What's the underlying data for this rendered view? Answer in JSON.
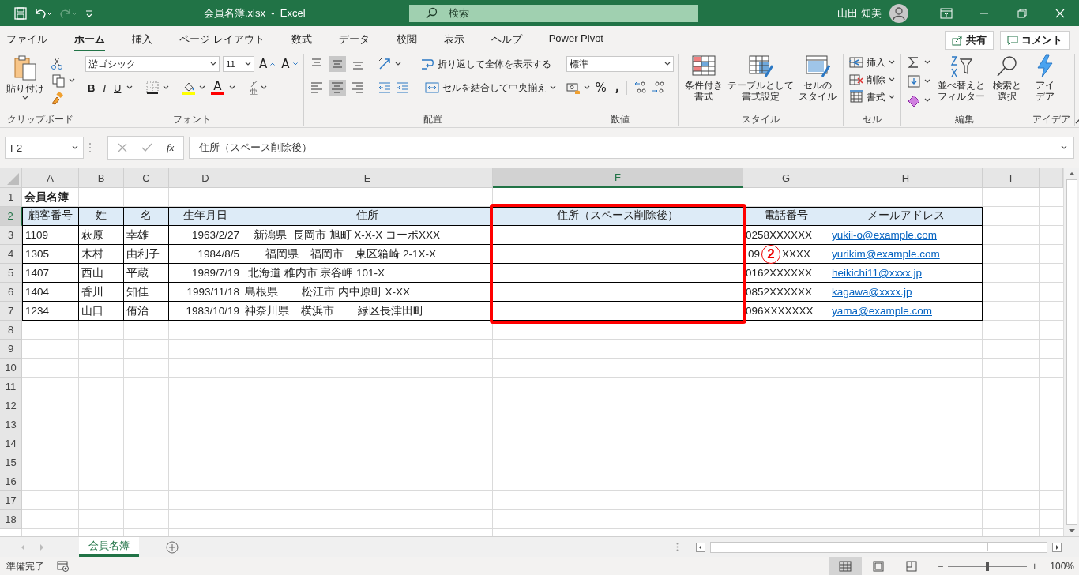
{
  "title_bar": {
    "file_title": "会員名簿.xlsx  -  Excel",
    "search_placeholder": "検索",
    "user": "山田 知美"
  },
  "ribbon_tabs": [
    {
      "label": "ファイル",
      "selected": false
    },
    {
      "label": "ホーム",
      "selected": true
    },
    {
      "label": "挿入",
      "selected": false
    },
    {
      "label": "ページ レイアウト",
      "selected": false
    },
    {
      "label": "数式",
      "selected": false
    },
    {
      "label": "データ",
      "selected": false
    },
    {
      "label": "校閲",
      "selected": false
    },
    {
      "label": "表示",
      "selected": false
    },
    {
      "label": "ヘルプ",
      "selected": false
    },
    {
      "label": "Power Pivot",
      "selected": false
    }
  ],
  "share_button": "共有",
  "comment_button": "コメント",
  "ribbon": {
    "clipboard": {
      "label": "クリップボード",
      "paste": "貼り付け"
    },
    "font": {
      "label": "フォント",
      "font_name": "游ゴシック",
      "font_size": "11",
      "grow": "A",
      "shrink": "A",
      "bold": "B",
      "italic": "I",
      "underline": "U",
      "font_color": "A",
      "phonetic": [
        "ア",
        "亜"
      ]
    },
    "alignment": {
      "label": "配置",
      "wrap_text": "折り返して全体を表示する",
      "merge": "セルを結合して中央揃え",
      "vertical": [
        {
          "kind": "top",
          "selected": false
        },
        {
          "kind": "middle",
          "selected": true
        },
        {
          "kind": "bottom",
          "selected": false
        }
      ],
      "horizontal": [
        {
          "kind": "left",
          "selected": false
        },
        {
          "kind": "center",
          "selected": true
        },
        {
          "kind": "right",
          "selected": false
        }
      ]
    },
    "number": {
      "label": "数値",
      "format": "標準",
      "percent": "%",
      "comma": ","
    },
    "styles": {
      "label": "スタイル",
      "buttons": [
        {
          "kind": "conditional",
          "lines": [
            "条件付き",
            "書式"
          ]
        },
        {
          "kind": "table",
          "lines": [
            "テーブルとして",
            "書式設定"
          ]
        },
        {
          "kind": "cell",
          "lines": [
            "セルの",
            "スタイル"
          ]
        }
      ]
    },
    "cells": {
      "label": "セル",
      "buttons": [
        {
          "kind": "insert",
          "label": "挿入"
        },
        {
          "kind": "delete",
          "label": "削除"
        },
        {
          "kind": "format",
          "label": "書式"
        }
      ]
    },
    "editing": {
      "label": "編集",
      "sort": [
        "並べ替えと",
        "フィルター"
      ],
      "find": [
        "検索と",
        "選択"
      ]
    },
    "ideas": {
      "label": "アイデア",
      "button": [
        "アイ",
        "デア"
      ]
    }
  },
  "formula_bar": {
    "name_box": "F2",
    "fx": "fx",
    "formula": "住所（スペース削除後）"
  },
  "columns": [
    {
      "label": "A",
      "selected": false,
      "highlighted": false
    },
    {
      "label": "B",
      "selected": false,
      "highlighted": false
    },
    {
      "label": "C",
      "selected": false,
      "highlighted": false
    },
    {
      "label": "D",
      "selected": false,
      "highlighted": false
    },
    {
      "label": "E",
      "selected": false,
      "highlighted": false
    },
    {
      "label": "F",
      "selected": true,
      "highlighted": true
    },
    {
      "label": "G",
      "selected": false,
      "highlighted": false
    },
    {
      "label": "H",
      "selected": false,
      "highlighted": false
    },
    {
      "label": "I",
      "selected": false,
      "highlighted": false
    }
  ],
  "rows": [
    {
      "number": "1",
      "selected": false,
      "kind": "title",
      "cells": [
        "会員名簿"
      ]
    },
    {
      "number": "2",
      "selected": true,
      "kind": "header",
      "cells": [
        "顧客番号",
        "姓",
        "名",
        "生年月日",
        "住所",
        "住所（スペース削除後）",
        "電話番号",
        "メールアドレス"
      ]
    },
    {
      "number": "3",
      "selected": false,
      "kind": "data",
      "cells": [
        "1109",
        "萩原",
        "幸雄",
        "1963/2/27",
        "   新潟県  長岡市 旭町 X-X-X コーポXXX",
        "",
        "0258XXXXXX",
        {
          "kind": "link",
          "text": "yukii-o@example.com"
        }
      ]
    },
    {
      "number": "4",
      "selected": false,
      "kind": "data",
      "cells": [
        "1305",
        "木村",
        "由利子",
        "1984/8/5",
        "       福岡県    福岡市    東区箱崎 2-1X-X",
        "",
        {
          "kind": "marked",
          "before": "09",
          "mark": "2",
          "after": "XXXX"
        },
        {
          "kind": "link",
          "text": "yurikim@example.com"
        }
      ]
    },
    {
      "number": "5",
      "selected": false,
      "kind": "data",
      "cells": [
        "1407",
        "西山",
        "平蔵",
        "1989/7/19",
        " 北海道 稚内市 宗谷岬 101-X",
        "",
        "0162XXXXXX",
        {
          "kind": "link",
          "text": "heikichi11@xxxx.jp"
        }
      ]
    },
    {
      "number": "6",
      "selected": false,
      "kind": "data",
      "cells": [
        "1404",
        "香川",
        "知佳",
        "1993/11/18",
        "島根県        松江市 内中原町 X-XX",
        "",
        "0852XXXXXX",
        {
          "kind": "link",
          "text": "kagawa@xxxx.jp"
        }
      ]
    },
    {
      "number": "7",
      "selected": false,
      "kind": "data",
      "cells": [
        "1234",
        "山口",
        "侑治",
        "1983/10/19",
        "神奈川県    横浜市        緑区長津田町",
        "",
        "096XXXXXXX",
        {
          "kind": "link",
          "text": "yama@example.com"
        }
      ]
    },
    {
      "number": "8",
      "selected": false,
      "kind": "empty"
    },
    {
      "number": "9",
      "selected": false,
      "kind": "empty"
    },
    {
      "number": "10",
      "selected": false,
      "kind": "empty"
    },
    {
      "number": "11",
      "selected": false,
      "kind": "empty"
    },
    {
      "number": "12",
      "selected": false,
      "kind": "empty"
    },
    {
      "number": "13",
      "selected": false,
      "kind": "empty"
    },
    {
      "number": "14",
      "selected": false,
      "kind": "empty"
    },
    {
      "number": "15",
      "selected": false,
      "kind": "empty"
    },
    {
      "number": "16",
      "selected": false,
      "kind": "empty"
    },
    {
      "number": "17",
      "selected": false,
      "kind": "empty"
    },
    {
      "number": "18",
      "selected": false,
      "kind": "empty"
    }
  ],
  "sheet_tabs": [
    {
      "label": "会員名簿",
      "selected": true
    }
  ],
  "status_bar": {
    "status": "準備完了",
    "views": [
      {
        "kind": "normal",
        "selected": true
      },
      {
        "kind": "page_layout",
        "selected": false
      },
      {
        "kind": "page_break",
        "selected": false
      }
    ],
    "zoom_out": "−",
    "zoom_in": "+",
    "zoom": {
      "level": 0.5
    },
    "zoom_text": "100%"
  }
}
